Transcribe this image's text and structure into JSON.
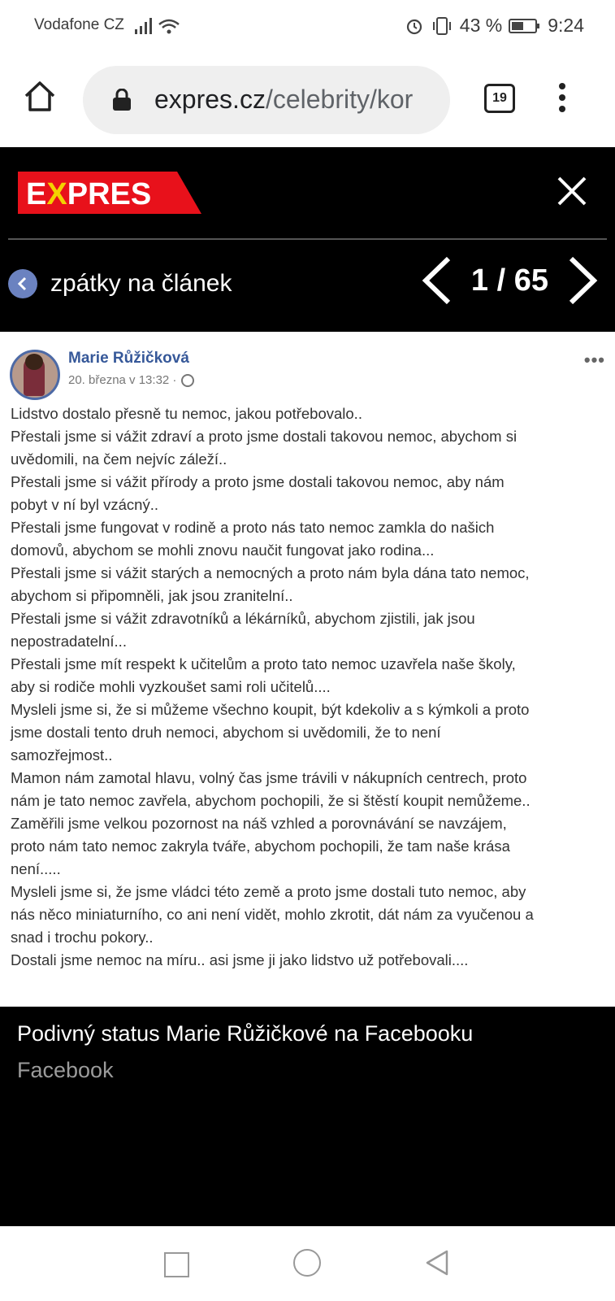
{
  "status": {
    "carrier": "Vodafone CZ",
    "battery": "43 %",
    "time": "9:24"
  },
  "browser": {
    "url_domain": "expres.cz",
    "url_path": "/celebrity/kor",
    "tab_count": "19"
  },
  "header": {
    "logo": "EXPRES",
    "back_label": "zpátky na článek",
    "pager": "1 / 65"
  },
  "post": {
    "author": "Marie Růžičková",
    "date": "20. března v 13:32 ·",
    "lines": [
      "Lidstvo dostalo přesně tu nemoc, jakou potřebovalo..",
      "Přestali jsme si vážit zdraví a proto jsme dostali takovou nemoc, abychom si",
      "uvědomili, na čem nejvíc záleží..",
      "Přestali jsme si vážit přírody a proto jsme dostali takovou nemoc, aby nám",
      "pobyt v ní byl vzácný..",
      "Přestali jsme fungovat v rodině a proto nás tato nemoc zamkla do našich",
      "domovů, abychom se mohli znovu naučit fungovat jako rodina...",
      "Přestali jsme si vážit starých a nemocných a proto nám byla dána tato nemoc,",
      "abychom si připomněli, jak jsou zranitelní..",
      "Přestali jsme si vážit zdravotníků a lékárníků, abychom zjistili, jak jsou",
      "nepostradatelní...",
      "Přestali jsme mít respekt k učitelům a proto tato nemoc uzavřela naše školy,",
      "aby si rodiče mohli vyzkoušet sami roli učitelů....",
      "Mysleli jsme si, že si můžeme všechno koupit, být kdekoliv a s kýmkoli a proto",
      "jsme dostali tento druh nemoci, abychom si uvědomili, že to není",
      "samozřejmost..",
      "Mamon nám zamotal hlavu, volný čas jsme trávili v nákupních centrech, proto",
      "nám je tato nemoc zavřela, abychom pochopili, že si štěstí koupit nemůžeme..",
      "Zaměřili jsme velkou pozornost na náš vzhled a porovnávání se navzájem,",
      "proto nám tato nemoc zakryla tváře, abychom pochopili, že tam naše krása",
      "není.....",
      "Mysleli jsme si, že jsme vládci této země a proto jsme dostali tuto nemoc, aby",
      "nás něco miniaturního, co ani není vidět, mohlo zkrotit, dát nám za vyučenou a",
      "snad i trochu pokory..",
      "Dostali jsme nemoc na míru.. asi jsme ji jako lidstvo už potřebovali...."
    ]
  },
  "caption": {
    "title": "Podivný status Marie Růžičkové na Facebooku",
    "source": "Facebook"
  },
  "colors": {
    "brand_red": "#e8111b",
    "fb_blue": "#365899",
    "back_blue": "#6b82c0"
  }
}
